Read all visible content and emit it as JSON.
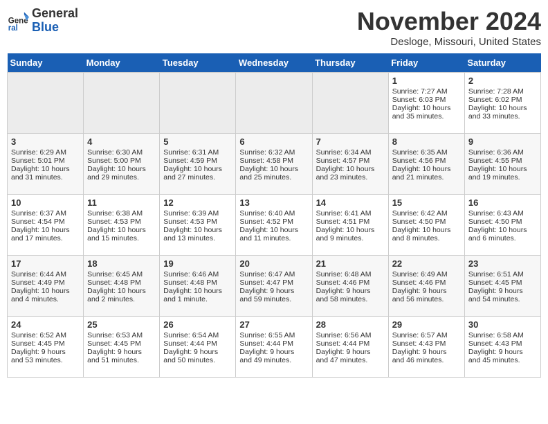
{
  "header": {
    "logo_line1": "General",
    "logo_line2": "Blue",
    "month": "November 2024",
    "location": "Desloge, Missouri, United States"
  },
  "days_of_week": [
    "Sunday",
    "Monday",
    "Tuesday",
    "Wednesday",
    "Thursday",
    "Friday",
    "Saturday"
  ],
  "weeks": [
    [
      {
        "day": "",
        "empty": true
      },
      {
        "day": "",
        "empty": true
      },
      {
        "day": "",
        "empty": true
      },
      {
        "day": "",
        "empty": true
      },
      {
        "day": "",
        "empty": true
      },
      {
        "day": "1",
        "sunrise": "Sunrise: 7:27 AM",
        "sunset": "Sunset: 6:03 PM",
        "daylight": "Daylight: 10 hours and 35 minutes."
      },
      {
        "day": "2",
        "sunrise": "Sunrise: 7:28 AM",
        "sunset": "Sunset: 6:02 PM",
        "daylight": "Daylight: 10 hours and 33 minutes."
      }
    ],
    [
      {
        "day": "3",
        "sunrise": "Sunrise: 6:29 AM",
        "sunset": "Sunset: 5:01 PM",
        "daylight": "Daylight: 10 hours and 31 minutes."
      },
      {
        "day": "4",
        "sunrise": "Sunrise: 6:30 AM",
        "sunset": "Sunset: 5:00 PM",
        "daylight": "Daylight: 10 hours and 29 minutes."
      },
      {
        "day": "5",
        "sunrise": "Sunrise: 6:31 AM",
        "sunset": "Sunset: 4:59 PM",
        "daylight": "Daylight: 10 hours and 27 minutes."
      },
      {
        "day": "6",
        "sunrise": "Sunrise: 6:32 AM",
        "sunset": "Sunset: 4:58 PM",
        "daylight": "Daylight: 10 hours and 25 minutes."
      },
      {
        "day": "7",
        "sunrise": "Sunrise: 6:34 AM",
        "sunset": "Sunset: 4:57 PM",
        "daylight": "Daylight: 10 hours and 23 minutes."
      },
      {
        "day": "8",
        "sunrise": "Sunrise: 6:35 AM",
        "sunset": "Sunset: 4:56 PM",
        "daylight": "Daylight: 10 hours and 21 minutes."
      },
      {
        "day": "9",
        "sunrise": "Sunrise: 6:36 AM",
        "sunset": "Sunset: 4:55 PM",
        "daylight": "Daylight: 10 hours and 19 minutes."
      }
    ],
    [
      {
        "day": "10",
        "sunrise": "Sunrise: 6:37 AM",
        "sunset": "Sunset: 4:54 PM",
        "daylight": "Daylight: 10 hours and 17 minutes."
      },
      {
        "day": "11",
        "sunrise": "Sunrise: 6:38 AM",
        "sunset": "Sunset: 4:53 PM",
        "daylight": "Daylight: 10 hours and 15 minutes."
      },
      {
        "day": "12",
        "sunrise": "Sunrise: 6:39 AM",
        "sunset": "Sunset: 4:53 PM",
        "daylight": "Daylight: 10 hours and 13 minutes."
      },
      {
        "day": "13",
        "sunrise": "Sunrise: 6:40 AM",
        "sunset": "Sunset: 4:52 PM",
        "daylight": "Daylight: 10 hours and 11 minutes."
      },
      {
        "day": "14",
        "sunrise": "Sunrise: 6:41 AM",
        "sunset": "Sunset: 4:51 PM",
        "daylight": "Daylight: 10 hours and 9 minutes."
      },
      {
        "day": "15",
        "sunrise": "Sunrise: 6:42 AM",
        "sunset": "Sunset: 4:50 PM",
        "daylight": "Daylight: 10 hours and 8 minutes."
      },
      {
        "day": "16",
        "sunrise": "Sunrise: 6:43 AM",
        "sunset": "Sunset: 4:50 PM",
        "daylight": "Daylight: 10 hours and 6 minutes."
      }
    ],
    [
      {
        "day": "17",
        "sunrise": "Sunrise: 6:44 AM",
        "sunset": "Sunset: 4:49 PM",
        "daylight": "Daylight: 10 hours and 4 minutes."
      },
      {
        "day": "18",
        "sunrise": "Sunrise: 6:45 AM",
        "sunset": "Sunset: 4:48 PM",
        "daylight": "Daylight: 10 hours and 2 minutes."
      },
      {
        "day": "19",
        "sunrise": "Sunrise: 6:46 AM",
        "sunset": "Sunset: 4:48 PM",
        "daylight": "Daylight: 10 hours and 1 minute."
      },
      {
        "day": "20",
        "sunrise": "Sunrise: 6:47 AM",
        "sunset": "Sunset: 4:47 PM",
        "daylight": "Daylight: 9 hours and 59 minutes."
      },
      {
        "day": "21",
        "sunrise": "Sunrise: 6:48 AM",
        "sunset": "Sunset: 4:46 PM",
        "daylight": "Daylight: 9 hours and 58 minutes."
      },
      {
        "day": "22",
        "sunrise": "Sunrise: 6:49 AM",
        "sunset": "Sunset: 4:46 PM",
        "daylight": "Daylight: 9 hours and 56 minutes."
      },
      {
        "day": "23",
        "sunrise": "Sunrise: 6:51 AM",
        "sunset": "Sunset: 4:45 PM",
        "daylight": "Daylight: 9 hours and 54 minutes."
      }
    ],
    [
      {
        "day": "24",
        "sunrise": "Sunrise: 6:52 AM",
        "sunset": "Sunset: 4:45 PM",
        "daylight": "Daylight: 9 hours and 53 minutes."
      },
      {
        "day": "25",
        "sunrise": "Sunrise: 6:53 AM",
        "sunset": "Sunset: 4:45 PM",
        "daylight": "Daylight: 9 hours and 51 minutes."
      },
      {
        "day": "26",
        "sunrise": "Sunrise: 6:54 AM",
        "sunset": "Sunset: 4:44 PM",
        "daylight": "Daylight: 9 hours and 50 minutes."
      },
      {
        "day": "27",
        "sunrise": "Sunrise: 6:55 AM",
        "sunset": "Sunset: 4:44 PM",
        "daylight": "Daylight: 9 hours and 49 minutes."
      },
      {
        "day": "28",
        "sunrise": "Sunrise: 6:56 AM",
        "sunset": "Sunset: 4:44 PM",
        "daylight": "Daylight: 9 hours and 47 minutes."
      },
      {
        "day": "29",
        "sunrise": "Sunrise: 6:57 AM",
        "sunset": "Sunset: 4:43 PM",
        "daylight": "Daylight: 9 hours and 46 minutes."
      },
      {
        "day": "30",
        "sunrise": "Sunrise: 6:58 AM",
        "sunset": "Sunset: 4:43 PM",
        "daylight": "Daylight: 9 hours and 45 minutes."
      }
    ]
  ]
}
